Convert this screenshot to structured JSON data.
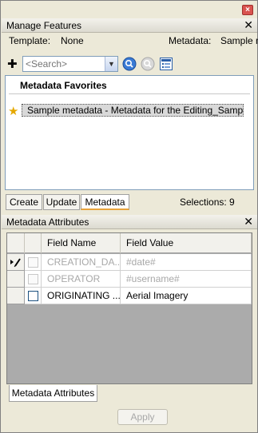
{
  "window": {
    "close_glyph": "×"
  },
  "manage_features": {
    "title": "Manage Features",
    "close_glyph": "✕",
    "template_label": "Template:",
    "template_value": "None",
    "metadata_label": "Metadata:",
    "metadata_value": "Sample m",
    "toolbar": {
      "add_glyph": "✚",
      "search_placeholder": "<Search>",
      "dropdown_glyph": "▼",
      "icons": [
        "add-icon",
        "search-icon",
        "clear-search-icon",
        "list-view-icon"
      ]
    },
    "favorites": {
      "title": "Metadata Favorites",
      "items": [
        {
          "label": "Sample metadata - Metadata for the Editing_Sampl...",
          "icon": "star-icon",
          "selected": true
        }
      ]
    },
    "tabs": [
      {
        "label": "Create",
        "active": false
      },
      {
        "label": "Update",
        "active": false
      },
      {
        "label": "Metadata",
        "active": true
      }
    ],
    "selections": "Selections: 9"
  },
  "metadata_attributes": {
    "title": "Metadata Attributes",
    "close_glyph": "✕",
    "columns": [
      "Field Name",
      "Field Value"
    ],
    "rows": [
      {
        "field_name": "CREATION_DA...",
        "field_value": "#date#",
        "enabled": false,
        "checked": false,
        "edit_icon": true
      },
      {
        "field_name": "OPERATOR",
        "field_value": "#username#",
        "enabled": false,
        "checked": false,
        "edit_icon": false
      },
      {
        "field_name": "ORIGINATING ...",
        "field_value": "Aerial Imagery",
        "enabled": true,
        "checked": false,
        "edit_icon": false
      }
    ],
    "bottom_tab": "Metadata Attributes",
    "apply_label": "Apply",
    "accent_color": "#e8a33c"
  }
}
